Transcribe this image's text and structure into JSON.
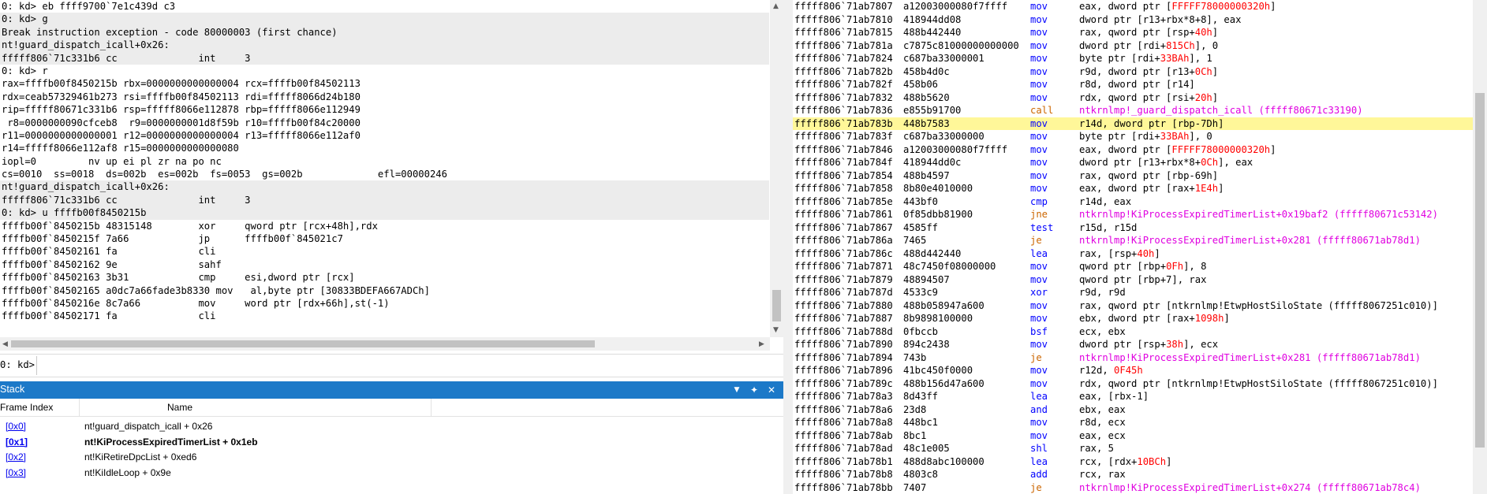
{
  "command_window": {
    "lines": [
      "0: kd> eb ffff9700`7e1c439d c3",
      "0: kd> g",
      "Break instruction exception - code 80000003 (first chance)",
      "nt!guard_dispatch_icall+0x26:",
      "fffff806`71c331b6 cc              int     3",
      "0: kd> r",
      "rax=ffffb00f8450215b rbx=0000000000000004 rcx=ffffb00f84502113",
      "rdx=ceab57329461b273 rsi=ffffb00f84502113 rdi=fffff8066d24b180",
      "rip=fffff80671c331b6 rsp=fffff8066e112878 rbp=fffff8066e112949",
      " r8=0000000090cfceb8  r9=0000000001d8f59b r10=ffffb00f84c20000",
      "r11=0000000000000001 r12=0000000000000004 r13=fffff8066e112af0",
      "r14=fffff8066e112af8 r15=0000000000000080",
      "iopl=0         nv up ei pl zr na po nc",
      "cs=0010  ss=0018  ds=002b  es=002b  fs=0053  gs=002b             efl=00000246",
      "nt!guard_dispatch_icall+0x26:",
      "fffff806`71c331b6 cc              int     3",
      "0: kd> u ffffb00f8450215b",
      "ffffb00f`8450215b 48315148        xor     qword ptr [rcx+48h],rdx",
      "ffffb00f`8450215f 7a66            jp      ffffb00f`845021c7",
      "ffffb00f`84502161 fa              cli",
      "ffffb00f`84502162 9e              sahf",
      "ffffb00f`84502163 3b31            cmp     esi,dword ptr [rcx]",
      "ffffb00f`84502165 a0dc7a66fade3b8330 mov   al,byte ptr [30833BDEFA667ADCh]",
      "ffffb00f`8450216e 8c7a66          mov     word ptr [rdx+66h],st(-1)",
      "ffffb00f`84502171 fa              cli"
    ],
    "shaded_lines": [
      1,
      2,
      3,
      4,
      14,
      15,
      16
    ],
    "prompt": "0: kd>",
    "input_value": ""
  },
  "stack": {
    "title": "Stack",
    "columns": [
      "Frame Index",
      "Name"
    ],
    "rows": [
      {
        "index": "[0x0]",
        "name": "nt!guard_dispatch_icall + 0x26",
        "selected": false
      },
      {
        "index": "[0x1]",
        "name": "nt!KiProcessExpiredTimerList + 0x1eb",
        "selected": true
      },
      {
        "index": "[0x2]",
        "name": "nt!KiRetireDpcList + 0xed6",
        "selected": false
      },
      {
        "index": "[0x3]",
        "name": "nt!KiIdleLoop + 0x9e",
        "selected": false
      }
    ],
    "buttons": {
      "menu": "▼",
      "pin": "✦",
      "close": "✕"
    }
  },
  "disassembly": {
    "current_line": 9,
    "lines": [
      {
        "addr": "fffff806`71ab7807",
        "bytes": "a12003000080f7ffff",
        "mnem": "mov",
        "ops": "eax, dword ptr [FFFFF78000000320h]",
        "kind": "normal"
      },
      {
        "addr": "fffff806`71ab7810",
        "bytes": "418944dd08",
        "mnem": "mov",
        "ops": "dword ptr [r13+rbx*8+8], eax",
        "kind": "normal"
      },
      {
        "addr": "fffff806`71ab7815",
        "bytes": "488b442440",
        "mnem": "mov",
        "ops": "rax, qword ptr [rsp+40h]",
        "kind": "normal"
      },
      {
        "addr": "fffff806`71ab781a",
        "bytes": "c7875c81000000000000",
        "mnem": "mov",
        "ops": "dword ptr [rdi+815Ch], 0",
        "kind": "normal"
      },
      {
        "addr": "fffff806`71ab7824",
        "bytes": "c687ba33000001",
        "mnem": "mov",
        "ops": "byte ptr [rdi+33BAh], 1",
        "kind": "normal"
      },
      {
        "addr": "fffff806`71ab782b",
        "bytes": "458b4d0c",
        "mnem": "mov",
        "ops": "r9d, dword ptr [r13+0Ch]",
        "kind": "normal"
      },
      {
        "addr": "fffff806`71ab782f",
        "bytes": "458b06",
        "mnem": "mov",
        "ops": "r8d, dword ptr [r14]",
        "kind": "normal"
      },
      {
        "addr": "fffff806`71ab7832",
        "bytes": "488b5620",
        "mnem": "mov",
        "ops": "rdx, qword ptr [rsi+20h]",
        "kind": "normal"
      },
      {
        "addr": "fffff806`71ab7836",
        "bytes": "e855b91700",
        "mnem": "call",
        "ops": "ntkrnlmp!_guard_dispatch_icall (fffff80671c33190)",
        "kind": "call"
      },
      {
        "addr": "fffff806`71ab783b",
        "bytes": "448b7583",
        "mnem": "mov",
        "ops": "r14d, dword ptr [rbp-7Dh]",
        "kind": "normal"
      },
      {
        "addr": "fffff806`71ab783f",
        "bytes": "c687ba33000000",
        "mnem": "mov",
        "ops": "byte ptr [rdi+33BAh], 0",
        "kind": "normal"
      },
      {
        "addr": "fffff806`71ab7846",
        "bytes": "a12003000080f7ffff",
        "mnem": "mov",
        "ops": "eax, dword ptr [FFFFF78000000320h]",
        "kind": "normal"
      },
      {
        "addr": "fffff806`71ab784f",
        "bytes": "418944dd0c",
        "mnem": "mov",
        "ops": "dword ptr [r13+rbx*8+0Ch], eax",
        "kind": "normal"
      },
      {
        "addr": "fffff806`71ab7854",
        "bytes": "488b4597",
        "mnem": "mov",
        "ops": "rax, qword ptr [rbp-69h]",
        "kind": "normal"
      },
      {
        "addr": "fffff806`71ab7858",
        "bytes": "8b80e4010000",
        "mnem": "mov",
        "ops": "eax, dword ptr [rax+1E4h]",
        "kind": "normal"
      },
      {
        "addr": "fffff806`71ab785e",
        "bytes": "443bf0",
        "mnem": "cmp",
        "ops": "r14d, eax",
        "kind": "normal"
      },
      {
        "addr": "fffff806`71ab7861",
        "bytes": "0f85dbb81900",
        "mnem": "jne",
        "ops": "ntkrnlmp!KiProcessExpiredTimerList+0x19baf2 (fffff80671c53142)",
        "kind": "jmp"
      },
      {
        "addr": "fffff806`71ab7867",
        "bytes": "4585ff",
        "mnem": "test",
        "ops": "r15d, r15d",
        "kind": "normal"
      },
      {
        "addr": "fffff806`71ab786a",
        "bytes": "7465",
        "mnem": "je",
        "ops": "ntkrnlmp!KiProcessExpiredTimerList+0x281 (fffff80671ab78d1)",
        "kind": "jmp"
      },
      {
        "addr": "fffff806`71ab786c",
        "bytes": "488d442440",
        "mnem": "lea",
        "ops": "rax, [rsp+40h]",
        "kind": "normal"
      },
      {
        "addr": "fffff806`71ab7871",
        "bytes": "48c7450f08000000",
        "mnem": "mov",
        "ops": "qword ptr [rbp+0Fh], 8",
        "kind": "normal"
      },
      {
        "addr": "fffff806`71ab7879",
        "bytes": "48894507",
        "mnem": "mov",
        "ops": "qword ptr [rbp+7], rax",
        "kind": "normal"
      },
      {
        "addr": "fffff806`71ab787d",
        "bytes": "4533c9",
        "mnem": "xor",
        "ops": "r9d, r9d",
        "kind": "normal"
      },
      {
        "addr": "fffff806`71ab7880",
        "bytes": "488b058947a600",
        "mnem": "mov",
        "ops": "rax, qword ptr [ntkrnlmp!EtwpHostSiloState (fffff8067251c010)]",
        "kind": "normal"
      },
      {
        "addr": "fffff806`71ab7887",
        "bytes": "8b9898100000",
        "mnem": "mov",
        "ops": "ebx, dword ptr [rax+1098h]",
        "kind": "normal"
      },
      {
        "addr": "fffff806`71ab788d",
        "bytes": "0fbccb",
        "mnem": "bsf",
        "ops": "ecx, ebx",
        "kind": "normal"
      },
      {
        "addr": "fffff806`71ab7890",
        "bytes": "894c2438",
        "mnem": "mov",
        "ops": "dword ptr [rsp+38h], ecx",
        "kind": "normal"
      },
      {
        "addr": "fffff806`71ab7894",
        "bytes": "743b",
        "mnem": "je",
        "ops": "ntkrnlmp!KiProcessExpiredTimerList+0x281 (fffff80671ab78d1)",
        "kind": "jmp"
      },
      {
        "addr": "fffff806`71ab7896",
        "bytes": "41bc450f0000",
        "mnem": "mov",
        "ops": "r12d, 0F45h",
        "kind": "normal"
      },
      {
        "addr": "fffff806`71ab789c",
        "bytes": "488b156d47a600",
        "mnem": "mov",
        "ops": "rdx, qword ptr [ntkrnlmp!EtwpHostSiloState (fffff8067251c010)]",
        "kind": "normal"
      },
      {
        "addr": "fffff806`71ab78a3",
        "bytes": "8d43ff",
        "mnem": "lea",
        "ops": "eax, [rbx-1]",
        "kind": "normal"
      },
      {
        "addr": "fffff806`71ab78a6",
        "bytes": "23d8",
        "mnem": "and",
        "ops": "ebx, eax",
        "kind": "normal"
      },
      {
        "addr": "fffff806`71ab78a8",
        "bytes": "448bc1",
        "mnem": "mov",
        "ops": "r8d, ecx",
        "kind": "normal"
      },
      {
        "addr": "fffff806`71ab78ab",
        "bytes": "8bc1",
        "mnem": "mov",
        "ops": "eax, ecx",
        "kind": "normal"
      },
      {
        "addr": "fffff806`71ab78ad",
        "bytes": "48c1e005",
        "mnem": "shl",
        "ops": "rax, 5",
        "kind": "normal"
      },
      {
        "addr": "fffff806`71ab78b1",
        "bytes": "488d8abc100000",
        "mnem": "lea",
        "ops": "rcx, [rdx+10BCh]",
        "kind": "normal"
      },
      {
        "addr": "fffff806`71ab78b8",
        "bytes": "4803c8",
        "mnem": "add",
        "ops": "rcx, rax",
        "kind": "normal"
      },
      {
        "addr": "fffff806`71ab78bb",
        "bytes": "7407",
        "mnem": "je",
        "ops": "ntkrnlmp!KiProcessExpiredTimerList+0x274 (fffff80671ab78c4)",
        "kind": "jmp"
      }
    ]
  },
  "colors": {
    "highlight": "#fff799",
    "stack_title_bg": "#1c79c8",
    "mnemonic": "#0000ff",
    "branch_target": "#e000e0",
    "hex_literal": "#ff0000"
  }
}
